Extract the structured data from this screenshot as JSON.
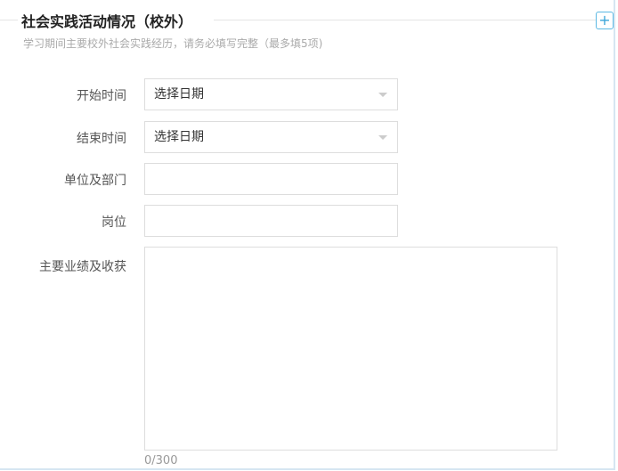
{
  "section": {
    "title": "社会实践活动情况（校外）",
    "subtitle": "学习期间主要校外社会实践经历，请务必填写完整（最多填5项)",
    "add_label": "+"
  },
  "fields": [
    {
      "label": "开始时间",
      "value": "选择日期"
    },
    {
      "label": "结束时间",
      "value": "选择日期"
    },
    {
      "label": "单位及部门",
      "value": ""
    },
    {
      "label": "岗位",
      "value": ""
    },
    {
      "label": "主要业绩及收获",
      "value": "",
      "counter": "0/300"
    }
  ]
}
